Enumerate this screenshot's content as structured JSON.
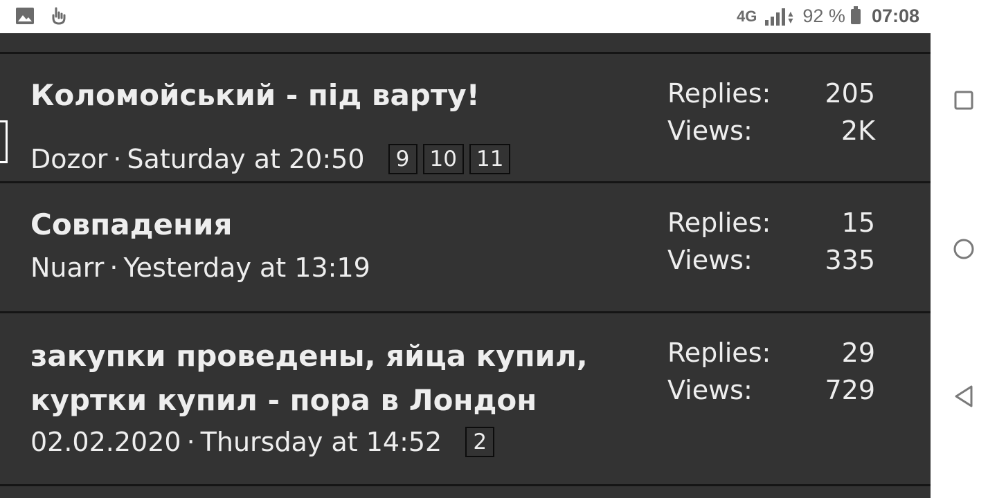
{
  "status_bar": {
    "network": "4G",
    "battery": "92 %",
    "time": "07:08",
    "icons": [
      "gallery-icon",
      "hand-pointer-icon",
      "signal-icon",
      "data-arrows-icon",
      "battery-icon"
    ]
  },
  "threads": [
    {
      "title": "Коломойський - під варту!",
      "author": "Dozor",
      "separator": "·",
      "date": "Saturday at 20:50",
      "pages": [
        "9",
        "10",
        "11"
      ],
      "replies_label": "Replies:",
      "replies": "205",
      "views_label": "Views:",
      "views": "2K"
    },
    {
      "title": "Совпадения",
      "author": "Nuarr",
      "separator": "·",
      "date": "Yesterday at 13:19",
      "pages": [],
      "replies_label": "Replies:",
      "replies": "15",
      "views_label": "Views:",
      "views": "335"
    },
    {
      "title": "закупки проведены, яйца купил, куртки купил - пора в Лондон",
      "author": "02.02.2020",
      "separator": "·",
      "date": "Thursday at 14:52",
      "pages": [
        "2"
      ],
      "replies_label": "Replies:",
      "replies": "29",
      "views_label": "Views:",
      "views": "729"
    }
  ],
  "nav": {
    "icons": [
      "recents-square-icon",
      "home-circle-icon",
      "back-triangle-icon"
    ]
  },
  "colors": {
    "background": "#333333",
    "divider": "#151515",
    "text": "#eeeeee"
  }
}
